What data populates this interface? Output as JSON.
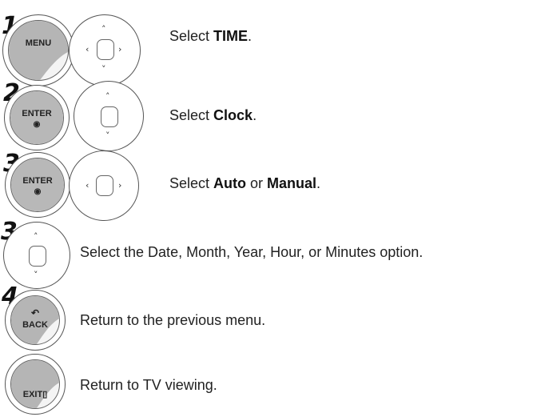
{
  "steps": [
    {
      "number": "1",
      "buttons": [
        {
          "type": "menu-key",
          "label": "MENU"
        },
        {
          "type": "dpad",
          "arrows": [
            "up",
            "down",
            "left",
            "right"
          ]
        }
      ],
      "text_prefix": "Select ",
      "text_bold": "TIME",
      "text_suffix": "."
    },
    {
      "number": "2",
      "buttons": [
        {
          "type": "enter-key",
          "label": "ENTER",
          "symbol": "◉"
        },
        {
          "type": "dpad",
          "arrows": [
            "up",
            "down"
          ]
        }
      ],
      "text_prefix": "Select ",
      "text_bold": "Clock",
      "text_suffix": "."
    },
    {
      "number": "3",
      "buttons": [
        {
          "type": "enter-key",
          "label": "ENTER",
          "symbol": "◉"
        },
        {
          "type": "dpad",
          "arrows": [
            "left",
            "right"
          ]
        }
      ],
      "text_prefix": "Select ",
      "text_bold": "Auto",
      "text_middle": " or ",
      "text_bold2": "Manual",
      "text_suffix": "."
    },
    {
      "number": "3",
      "buttons": [
        {
          "type": "dpad",
          "arrows": [
            "up",
            "down"
          ]
        }
      ],
      "text": "Select the Date, Month, Year, Hour, or Minutes option."
    },
    {
      "number": "4",
      "buttons": [
        {
          "type": "back-key",
          "label": "BACK",
          "symbol": "↶"
        }
      ],
      "text": "Return to the previous menu."
    },
    {
      "number": "",
      "buttons": [
        {
          "type": "exit-key",
          "label": "EXIT",
          "symbol": "▯"
        }
      ],
      "text": "Return to TV viewing."
    }
  ],
  "arrows": {
    "up": "˄",
    "down": "˅",
    "left": "‹",
    "right": "›"
  }
}
